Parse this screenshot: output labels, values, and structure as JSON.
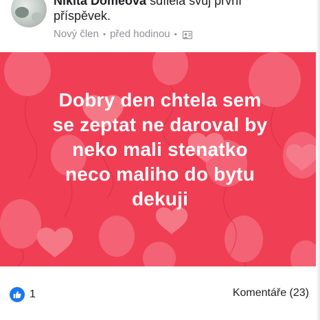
{
  "post": {
    "author": {
      "name": "Nikita Domeova",
      "action_line1": "sdílela svůj první",
      "action_line2": "příspěvek."
    },
    "meta": {
      "badge": "Nový člen",
      "time": "před hodinou",
      "audience_icon": "privacy-icon"
    },
    "image": {
      "background_color": "#f03e55",
      "text_lines": [
        "Dobry den chtela sem",
        "se zeptat ne daroval by",
        "neko mali stenatko",
        "neco maliho do bytu",
        "dekuji"
      ]
    },
    "reactions": {
      "icon": "thumbs-up-icon",
      "count": "1"
    },
    "comments": {
      "label": "Komentáře",
      "count": "(23)"
    }
  }
}
